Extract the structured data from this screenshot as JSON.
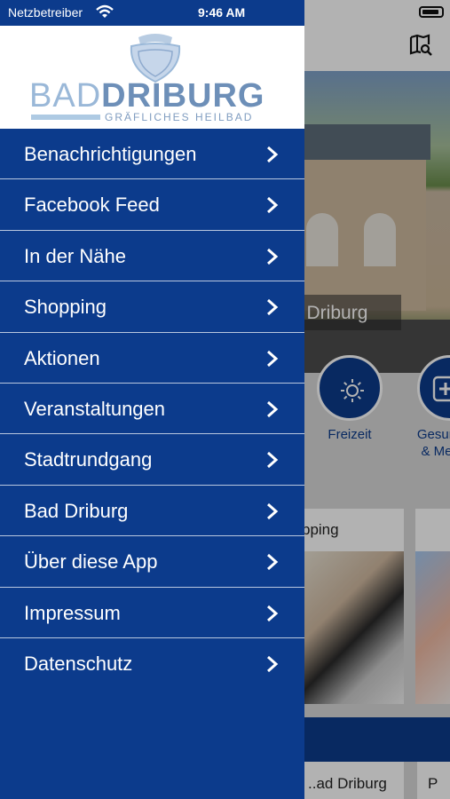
{
  "status_bar": {
    "carrier": "Netzbetreiber",
    "time": "9:46 AM"
  },
  "logo": {
    "word1": "BAD",
    "word2": "DRIBURG",
    "subtitle": "GRÄFLICHES HEILBAD"
  },
  "menu": {
    "items": [
      {
        "label": "Benachrichtigungen"
      },
      {
        "label": "Facebook Feed"
      },
      {
        "label": "In der Nähe"
      },
      {
        "label": "Shopping"
      },
      {
        "label": "Aktionen"
      },
      {
        "label": "Veranstaltungen"
      },
      {
        "label": "Stadtrundgang"
      },
      {
        "label": "Bad Driburg"
      },
      {
        "label": "Über diese App"
      },
      {
        "label": "Impressum"
      },
      {
        "label": "Datenschutz"
      }
    ]
  },
  "background_app": {
    "hero_caption": "d Driburg",
    "categories": [
      {
        "label": "Freizeit",
        "icon": "sun-icon"
      },
      {
        "label": "Gesun\n& Me",
        "icon": "plus-icon"
      }
    ],
    "cards": [
      {
        "title": "pping"
      }
    ],
    "tiles": [
      {
        "label": "..ad Driburg"
      },
      {
        "label": "P"
      }
    ]
  },
  "colors": {
    "brand_blue": "#0c3b8c",
    "divider": "#b9c7df",
    "logo_light": "#9ab8d8",
    "logo_dark": "#6d8fb8"
  }
}
